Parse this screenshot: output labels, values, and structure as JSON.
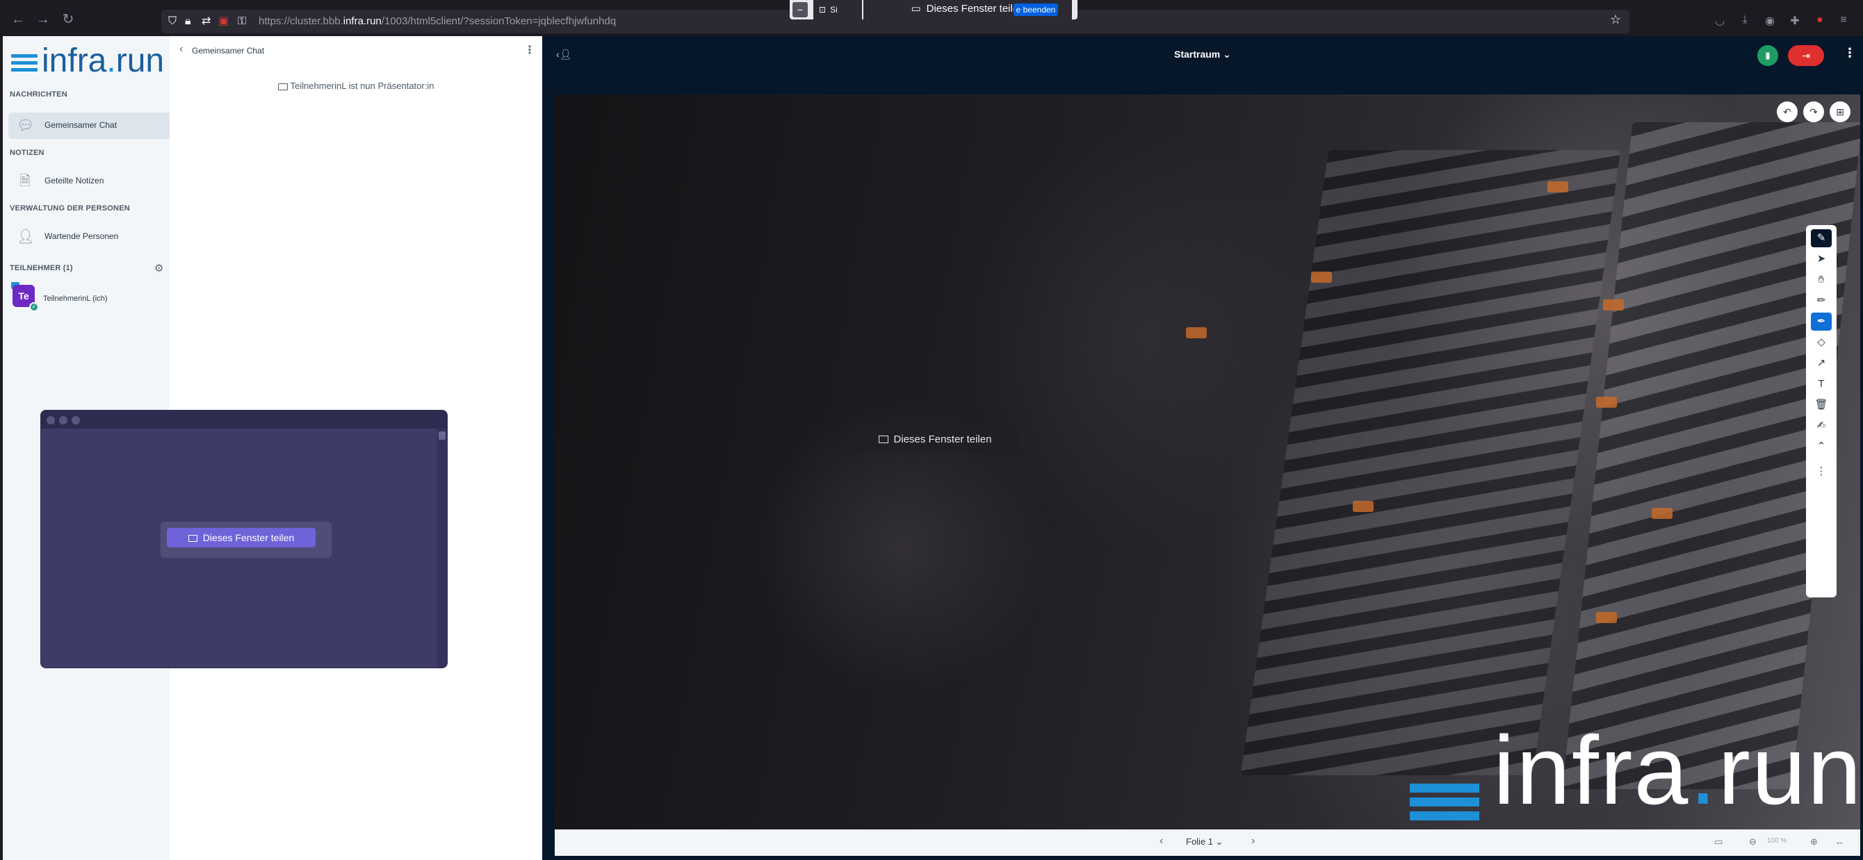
{
  "browser": {
    "url_prefix": "https://cluster.bbb.",
    "url_host": "infra.run",
    "url_path": "/1003/html5client/?sessionToken=jqblecfhjwfunhdq",
    "back_icon": "arrow-left-icon",
    "forward_icon": "arrow-right-icon",
    "reload_icon": "reload-icon"
  },
  "sharebar": {
    "doc_label": "Si",
    "title": "Dieses Fenster teilen",
    "stop_label": "e beenden"
  },
  "sidebar": {
    "logo_text_a": "infra",
    "logo_dot": ".",
    "logo_text_b": "run",
    "sections": {
      "messages": "NACHRICHTEN",
      "notes": "NOTIZEN",
      "people": "VERWALTUNG DER PERSONEN",
      "participants": "TEILNEHMER (1)"
    },
    "items": {
      "chat": "Gemeinsamer Chat",
      "notes": "Geteilte Notizen",
      "waiting": "Wartende Personen"
    },
    "user": {
      "initials": "Te",
      "name": "TeilnehmerinL (ich)"
    }
  },
  "chat": {
    "title": "Gemeinsamer Chat",
    "message": "TeilnehmerinL ist nun Präsentator:in"
  },
  "main": {
    "room_title": "Startraum",
    "slide_pill": "Dieses Fenster teilen",
    "slide_logo_a": "infra",
    "slide_logo_dot": ".",
    "slide_logo_b": "run",
    "slide_label": "Folie 1",
    "zoom": "100 %"
  },
  "preview": {
    "button_label": "Dieses Fenster teilen"
  },
  "colors": {
    "accent": "#1d90d6",
    "share_purple": "#6e63d9",
    "leave_red": "#e02f2f",
    "connection_green": "#1e9c64"
  }
}
